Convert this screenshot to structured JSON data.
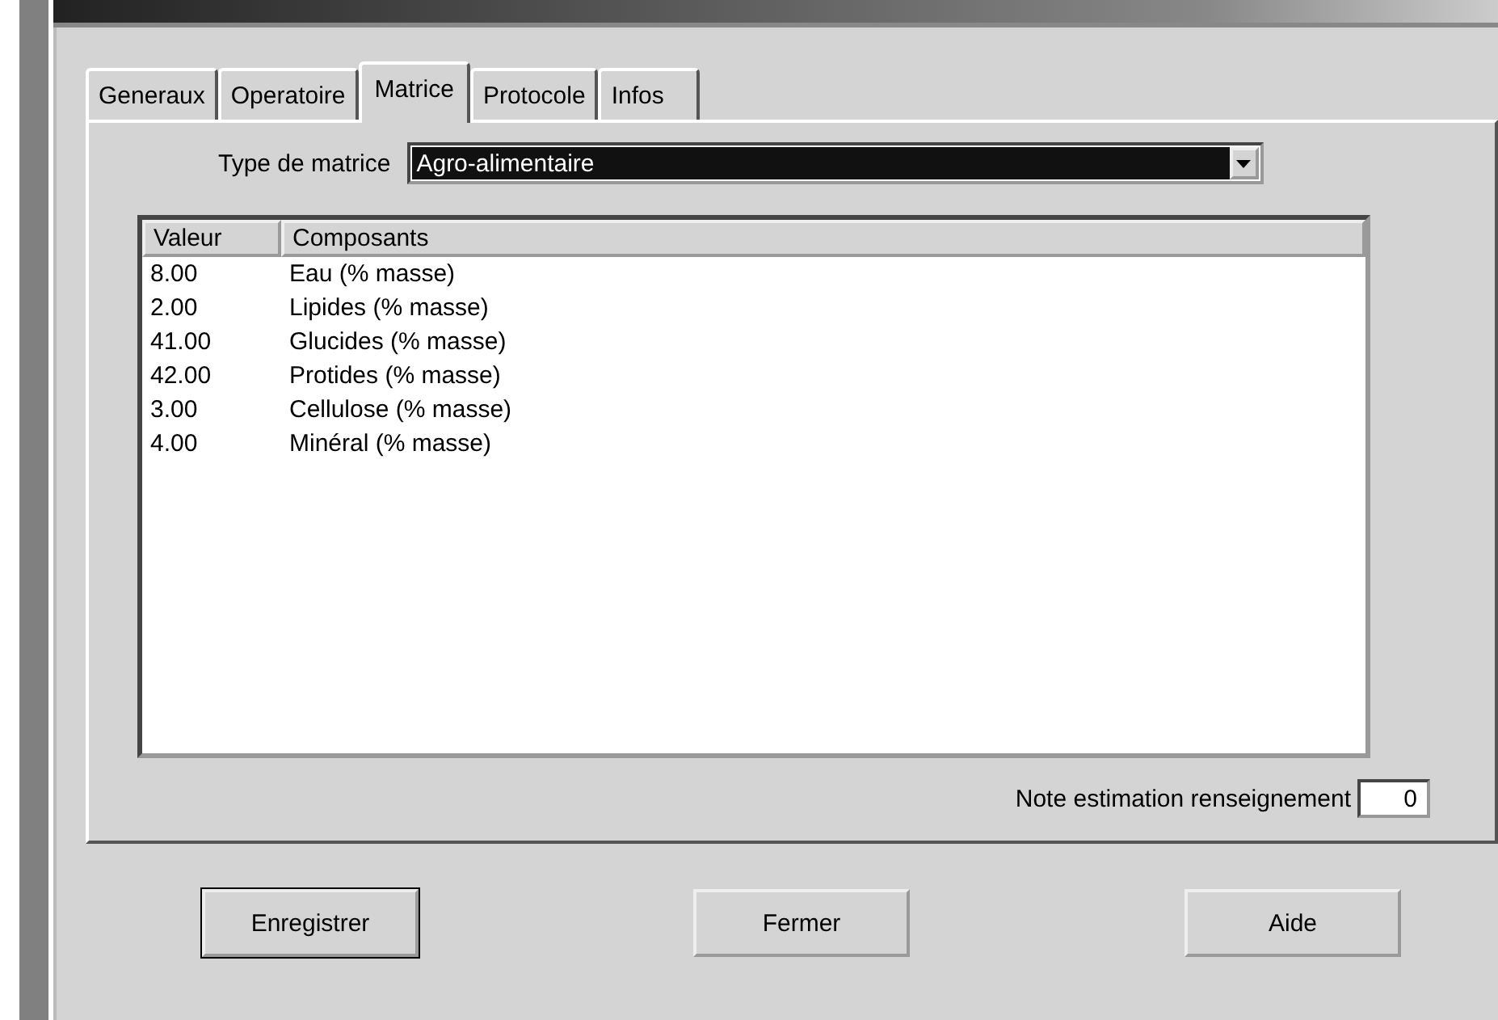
{
  "tabs": [
    {
      "label": "Generaux",
      "selected": false
    },
    {
      "label": "Operatoire",
      "selected": false
    },
    {
      "label": "Matrice",
      "selected": true
    },
    {
      "label": "Protocole",
      "selected": false
    },
    {
      "label": "Infos",
      "selected": false
    }
  ],
  "matrix_type": {
    "label": "Type de matrice",
    "value": "Agro-alimentaire"
  },
  "table": {
    "columns": [
      "Valeur",
      "Composants"
    ],
    "rows": [
      {
        "value": "8.00",
        "component": "Eau (% masse)"
      },
      {
        "value": "2.00",
        "component": "Lipides (% masse)"
      },
      {
        "value": "41.00",
        "component": "Glucides (% masse)"
      },
      {
        "value": "42.00",
        "component": "Protides (% masse)"
      },
      {
        "value": "3.00",
        "component": "Cellulose (% masse)"
      },
      {
        "value": "4.00",
        "component": "Minéral (% masse)"
      }
    ]
  },
  "note": {
    "label": "Note estimation renseignement",
    "value": "0"
  },
  "buttons": [
    {
      "label": "Enregistrer",
      "default": true
    },
    {
      "label": "Fermer",
      "default": false
    },
    {
      "label": "Aide",
      "default": false
    }
  ]
}
